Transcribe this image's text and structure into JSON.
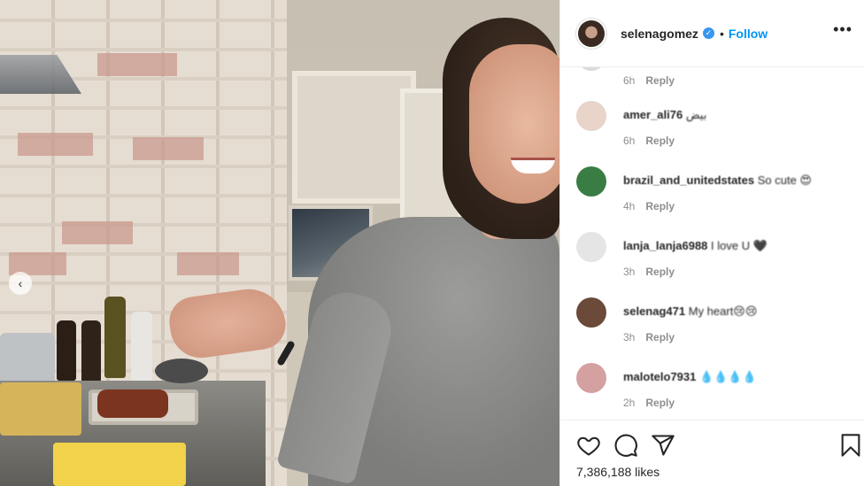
{
  "post": {
    "username": "selenagomez",
    "follow_label": "Follow",
    "dot_separator": "•",
    "more_glyph": "•••",
    "verified_glyph": "✓",
    "likes_text": "7,386,188 likes"
  },
  "photo": {
    "carousel_prev_glyph": "‹"
  },
  "comments": [
    {
      "user": "",
      "text": "",
      "time": "6h",
      "reply": "Reply",
      "avatar_color": "#dcdcdc"
    },
    {
      "user": "amer_ali76",
      "text": "بيض",
      "time": "6h",
      "reply": "Reply",
      "avatar_color": "#e8d4c8"
    },
    {
      "user": "brazil_and_unitedstates",
      "text": "So cute 😍",
      "time": "4h",
      "reply": "Reply",
      "avatar_color": "#3a7d44"
    },
    {
      "user": "lanja_lanja6988",
      "text": "I love U 🖤",
      "time": "3h",
      "reply": "Reply",
      "avatar_color": "#e5e5e5"
    },
    {
      "user": "selenag471",
      "text": "My heart😢😢",
      "time": "3h",
      "reply": "Reply",
      "avatar_color": "#6b4a3a"
    },
    {
      "user": "malotelo7931",
      "text": "💧💧💧💧",
      "time": "2h",
      "reply": "Reply",
      "avatar_color": "#d4a0a0"
    }
  ],
  "icons": {
    "like": "heart-icon",
    "comment": "comment-icon",
    "share": "share-icon",
    "save": "bookmark-icon"
  },
  "colors": {
    "accent": "#0095f6",
    "verified": "#3897f0",
    "muted": "#8e8e8e",
    "text": "#262626"
  }
}
